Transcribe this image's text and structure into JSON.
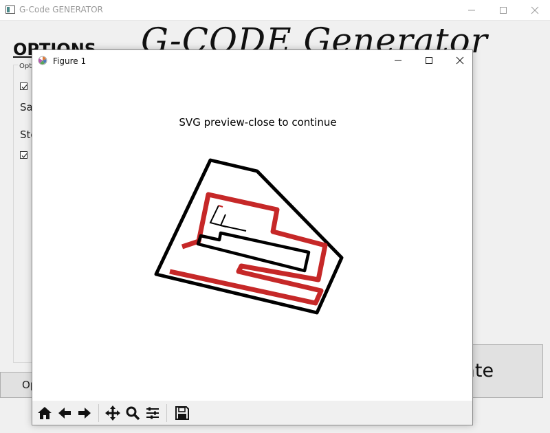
{
  "main_window": {
    "title": "G-Code GENERATOR",
    "heading_options": "OPTIONS",
    "big_title": "G-CODE Generator",
    "group_label": "Opti",
    "side_text_1": "Sa",
    "side_text_2": "Ste",
    "bottom_button_label": "Op",
    "generate_button_label": "Generate",
    "checkbox_1_checked": true,
    "checkbox_2_checked": true
  },
  "figure_window": {
    "title": "Figure 1",
    "plot_title": "SVG preview-close to continue",
    "toolbar": [
      {
        "name": "home-icon",
        "label": "Home"
      },
      {
        "name": "back-icon",
        "label": "Back"
      },
      {
        "name": "forward-icon",
        "label": "Forward"
      },
      {
        "name": "pan-icon",
        "label": "Pan"
      },
      {
        "name": "zoom-icon",
        "label": "Zoom"
      },
      {
        "name": "configure-subplots-icon",
        "label": "Subplots"
      },
      {
        "name": "save-icon",
        "label": "Save"
      }
    ]
  },
  "colors": {
    "outline_path": "#000000",
    "red_path": "#c62828",
    "window_bg": "#f0f0f0"
  }
}
